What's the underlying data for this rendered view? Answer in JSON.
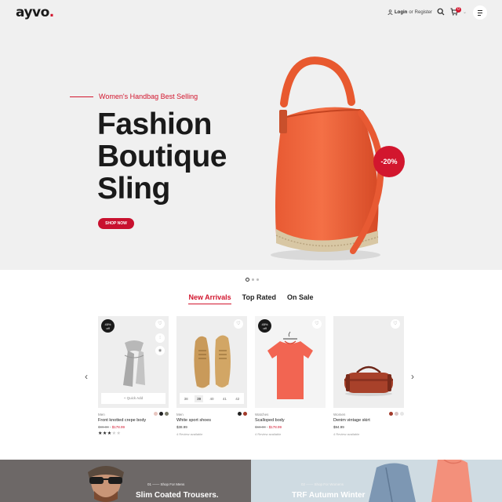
{
  "header": {
    "logo_text": "ayvo",
    "logo_dot": ".",
    "login_label": "Login",
    "or_label": "or",
    "register_label": "Register",
    "cart_count": "0",
    "icons": [
      "user-icon",
      "search-icon",
      "cart-icon",
      "chevron-down-icon",
      "menu-icon"
    ]
  },
  "hero": {
    "subtitle": "Women's Handbag Best Selling",
    "title_line1": "Fashion",
    "title_line2": "Boutique",
    "title_line3": "Sling",
    "cta": "SHOP NOW",
    "discount": "-20%",
    "slides": 3,
    "active_slide": 1
  },
  "tabs": [
    "New Arrivals",
    "Top Rated",
    "On Sale"
  ],
  "products": [
    {
      "sale_line1": "45%",
      "sale_line2": "off",
      "quick_add": "+ Quick Add",
      "category": "Men",
      "name": "Front knotted crepe body",
      "old_price": "$99.00",
      "new_price": "$178.99",
      "rating": 3,
      "swatches": [
        "#e8c6c0",
        "#222222",
        "#7a7a6a"
      ]
    },
    {
      "category": "Men",
      "name": "White sport shoes",
      "price": "$38.99",
      "review": "4 Review available",
      "sizes": [
        "38",
        "39",
        "40",
        "41",
        "42"
      ],
      "selected_size": "39",
      "swatches": [
        "#222222",
        "#a23a2a"
      ]
    },
    {
      "sale_line1": "45%",
      "sale_line2": "off",
      "category": "Watches",
      "name": "Scalloped body",
      "old_price": "$68.00",
      "new_price": "$178.99",
      "review": "4 Review available",
      "swatches": []
    },
    {
      "category": "Women",
      "name": "Denim vintage skirt",
      "price": "$94.99",
      "review": "4 Review available",
      "swatches": [
        "#a23a2a",
        "#d9c4c4",
        "#e6e6e6"
      ]
    }
  ],
  "promos": [
    {
      "number": "01",
      "label": "Shop For Mens",
      "title": "Slim Coated Trousers."
    },
    {
      "number": "02",
      "label": "Shop For Womens",
      "title": "TRF Autumn Winter"
    }
  ],
  "colors": {
    "accent": "#d2162e",
    "dark": "#1a1a1a",
    "hero_bg": "#f0f0f0"
  }
}
